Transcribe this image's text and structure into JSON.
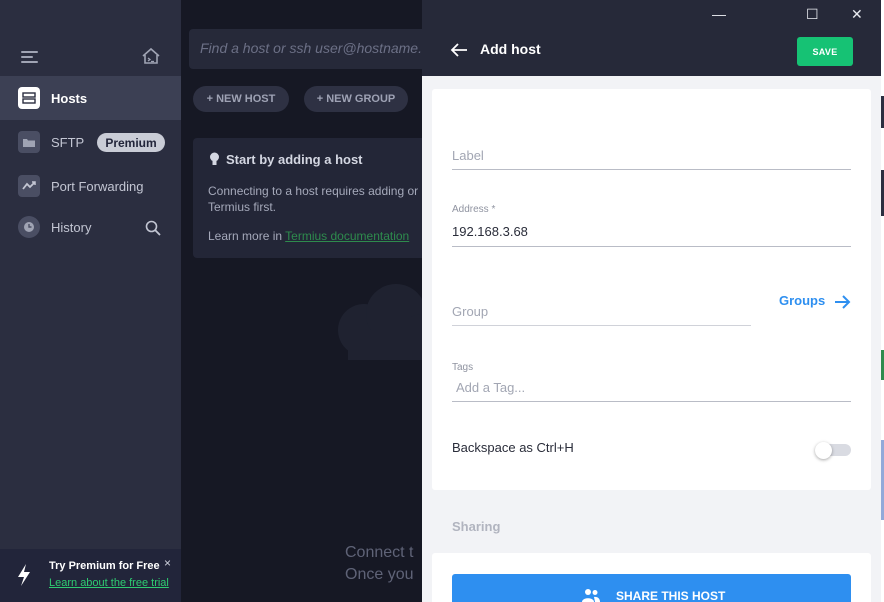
{
  "sidebar": {
    "items": [
      {
        "label": "Hosts"
      },
      {
        "label": "SFTP"
      },
      {
        "label": "Port Forwarding"
      },
      {
        "label": "History"
      }
    ],
    "premium_badge": "Premium",
    "promo": {
      "title": "Try Premium for Free",
      "link": "Learn about the free trial",
      "close": "×"
    }
  },
  "main": {
    "search_placeholder": "Find a host or ssh user@hostname...",
    "new_host_label": "+ NEW HOST",
    "new_group_label": "+ NEW GROUP",
    "hint": {
      "title": "Start by adding a host",
      "body": "Connecting to a host requires adding or Termius first.",
      "learn_prefix": "Learn more in",
      "learn_link": "Termius documentation"
    },
    "empty_line1": "Connect t",
    "empty_line2": "Once you"
  },
  "window": {
    "minimize": "—",
    "maximize": "☐",
    "close": "✕"
  },
  "panel": {
    "title": "Add host",
    "save_label": "SAVE",
    "label_placeholder": "Label",
    "address_label": "Address *",
    "address_value": "192.168.3.68",
    "group_placeholder": "Group",
    "groups_link": "Groups",
    "tags_label": "Tags",
    "tags_placeholder": "Add a Tag...",
    "backspace_label": "Backspace as Ctrl+H",
    "backspace_enabled": false,
    "sharing_title": "Sharing",
    "share_label": "SHARE THIS HOST"
  },
  "colors": {
    "accent_green": "#16c274",
    "accent_blue": "#2e8ff0",
    "sidebar_bg": "#2b2e40"
  },
  "icons": [
    "menu-icon",
    "home-icon",
    "hosts-icon",
    "sftp-folder-icon",
    "port-forwarding-icon",
    "history-clock-icon",
    "search-icon",
    "bolt-icon",
    "bulb-icon",
    "back-arrow-icon",
    "arrow-right-icon",
    "users-icon"
  ]
}
